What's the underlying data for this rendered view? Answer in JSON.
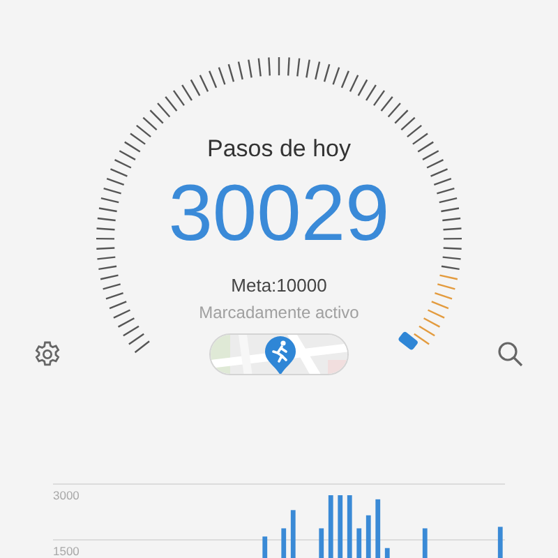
{
  "gauge": {
    "title": "Pasos de hoy",
    "steps": "30029",
    "goal": "Meta:10000",
    "activity": "Marcadamente activo"
  },
  "chart": {
    "chart_data": {
      "type": "bar",
      "ylim": [
        0,
        3000
      ],
      "yticks": [
        1500,
        3000
      ],
      "values": [
        null,
        null,
        null,
        null,
        null,
        null,
        null,
        null,
        null,
        null,
        null,
        null,
        null,
        null,
        null,
        null,
        null,
        null,
        null,
        null,
        null,
        null,
        1590,
        null,
        1810,
        2300,
        null,
        null,
        1810,
        2700,
        2700,
        2700,
        1810,
        2160,
        2590,
        1280,
        null,
        null,
        null,
        1810,
        null,
        null,
        null,
        null,
        null,
        null,
        null,
        1850
      ]
    }
  }
}
